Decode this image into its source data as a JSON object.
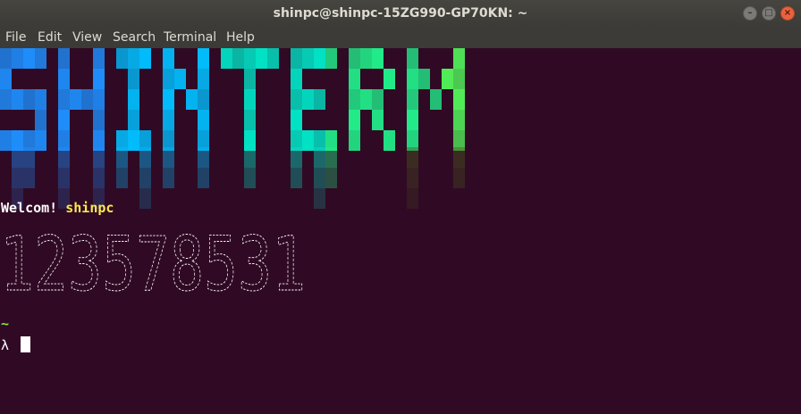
{
  "window": {
    "title": "shinpc@shinpc-15ZG990-GP70KN: ~",
    "buttons": {
      "minimize": "–",
      "maximize": "□",
      "close": "×"
    }
  },
  "menu": [
    "File",
    "Edit",
    "View",
    "Search",
    "Terminal",
    "Help"
  ],
  "terminal": {
    "banner": {
      "text": "SHINTERM",
      "gradient": [
        "#1e90ff",
        "#00bfff",
        "#00e5c8",
        "#21f08c",
        "#52f05a",
        "#8ef23b",
        "#b7f52a"
      ],
      "drip_color": "#4a5b1f"
    },
    "welcome_label": "Welcom!",
    "welcome_user": "shinpc",
    "ascii_art": "123578531",
    "prompt_cwd": "~",
    "prompt_symbol": "λ",
    "colors": {
      "background": "#300a24",
      "text": "#ffffff",
      "user": "#fce94f",
      "cwd": "#8ae234"
    }
  }
}
